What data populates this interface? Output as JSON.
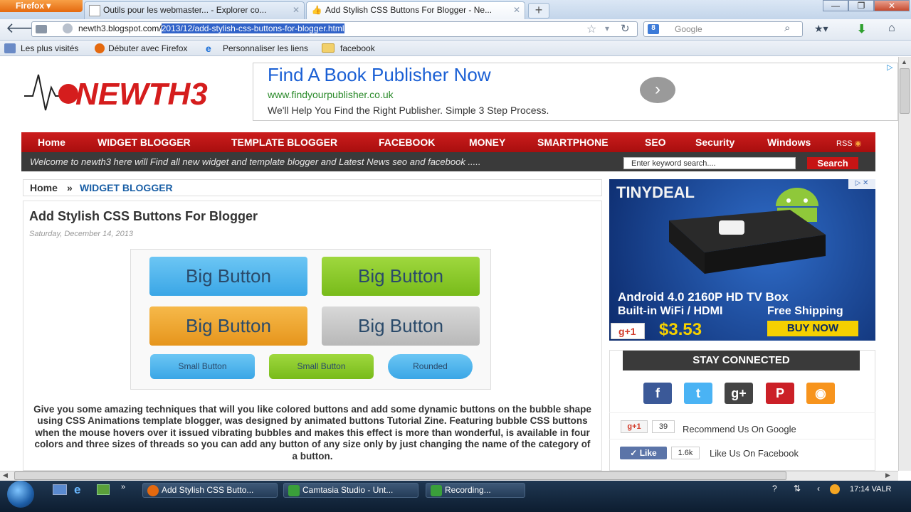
{
  "browser": {
    "app_button": "Firefox",
    "tabs": [
      {
        "title": "Outils pour les webmaster... - Explorer co..."
      },
      {
        "title": "Add Stylish CSS Buttons For Blogger - Ne..."
      }
    ],
    "url_plain": "newth3.blogspot.com/",
    "url_selected": "2013/12/add-stylish-css-buttons-for-blogger.html",
    "search_engine_placeholder": "Google",
    "bookmarks": [
      "Les plus visités",
      "Débuter avec Firefox",
      "Personnaliser les liens",
      "facebook"
    ]
  },
  "site": {
    "logo_text": "NEWTH3",
    "ad": {
      "title": "Find A Book Publisher Now",
      "url": "www.findyourpublisher.co.uk",
      "description": "We'll Help You Find the Right Publisher. Simple 3 Step Process."
    },
    "menu": [
      "Home",
      "WIDGET BLOGGER",
      "TEMPLATE BLOGGER",
      "FACEBOOK",
      "MONEY",
      "SMARTPHONE",
      "SEO",
      "Security",
      "Windows",
      "RSS"
    ],
    "welcome": "Welcome to newth3 here will Find all new widget and template blogger and Latest News seo and facebook .....",
    "search_placeholder": "Enter keyword search....",
    "search_button": "Search"
  },
  "breadcrumb": {
    "home": "Home",
    "separator": "»",
    "category": "WIDGET BLOGGER"
  },
  "post": {
    "title": "Add Stylish CSS Buttons For Blogger",
    "date": "Saturday, December 14, 2013",
    "demo_buttons": {
      "big": [
        "Big Button",
        "Big Button",
        "Big Button",
        "Big Button"
      ],
      "small": [
        "Small Button",
        "Small Button",
        "Rounded"
      ],
      "colors": {
        "blue": "#56b9ef",
        "green": "#8dcc2a",
        "orange": "#f0a830",
        "gray": "#c8c8c8"
      }
    },
    "body": "Give you some amazing techniques that will you like colored buttons and add some dynamic buttons on the bubble shape using CSS Animations template blogger, was designed by animated buttons Tutorial Zine. Featuring bubble CSS buttons when the mouse hovers over it issued vibrating bubbles and makes this effect is more than wonderful, is available in four colors and three sizes of threads so you can add any button of any size only by just changing the name of the category of a button."
  },
  "sidebar": {
    "banner": {
      "brand": "TINYDEAL",
      "line1": "Android 4.0 2160P HD TV Box",
      "line2": "Built-in WiFi / HDMI",
      "shipping": "Free Shipping",
      "price": "$3.53",
      "buy": "BUY NOW",
      "gplus": "g+1"
    },
    "stay_connected": "STAY CONNECTED",
    "social_icons": [
      "facebook-icon",
      "twitter-icon",
      "google-plus-icon",
      "pinterest-icon",
      "rss-icon"
    ],
    "recommend": {
      "button": "g+1",
      "count": "39",
      "text": "Recommend Us On Google"
    },
    "like": {
      "button": "Like",
      "count": "1.6k",
      "text": "Like Us On Facebook"
    }
  },
  "taskbar": {
    "items": [
      "Add Stylish CSS Butto...",
      "Camtasia Studio - Unt...",
      "Recording..."
    ],
    "clock": "17:14 VALR"
  }
}
